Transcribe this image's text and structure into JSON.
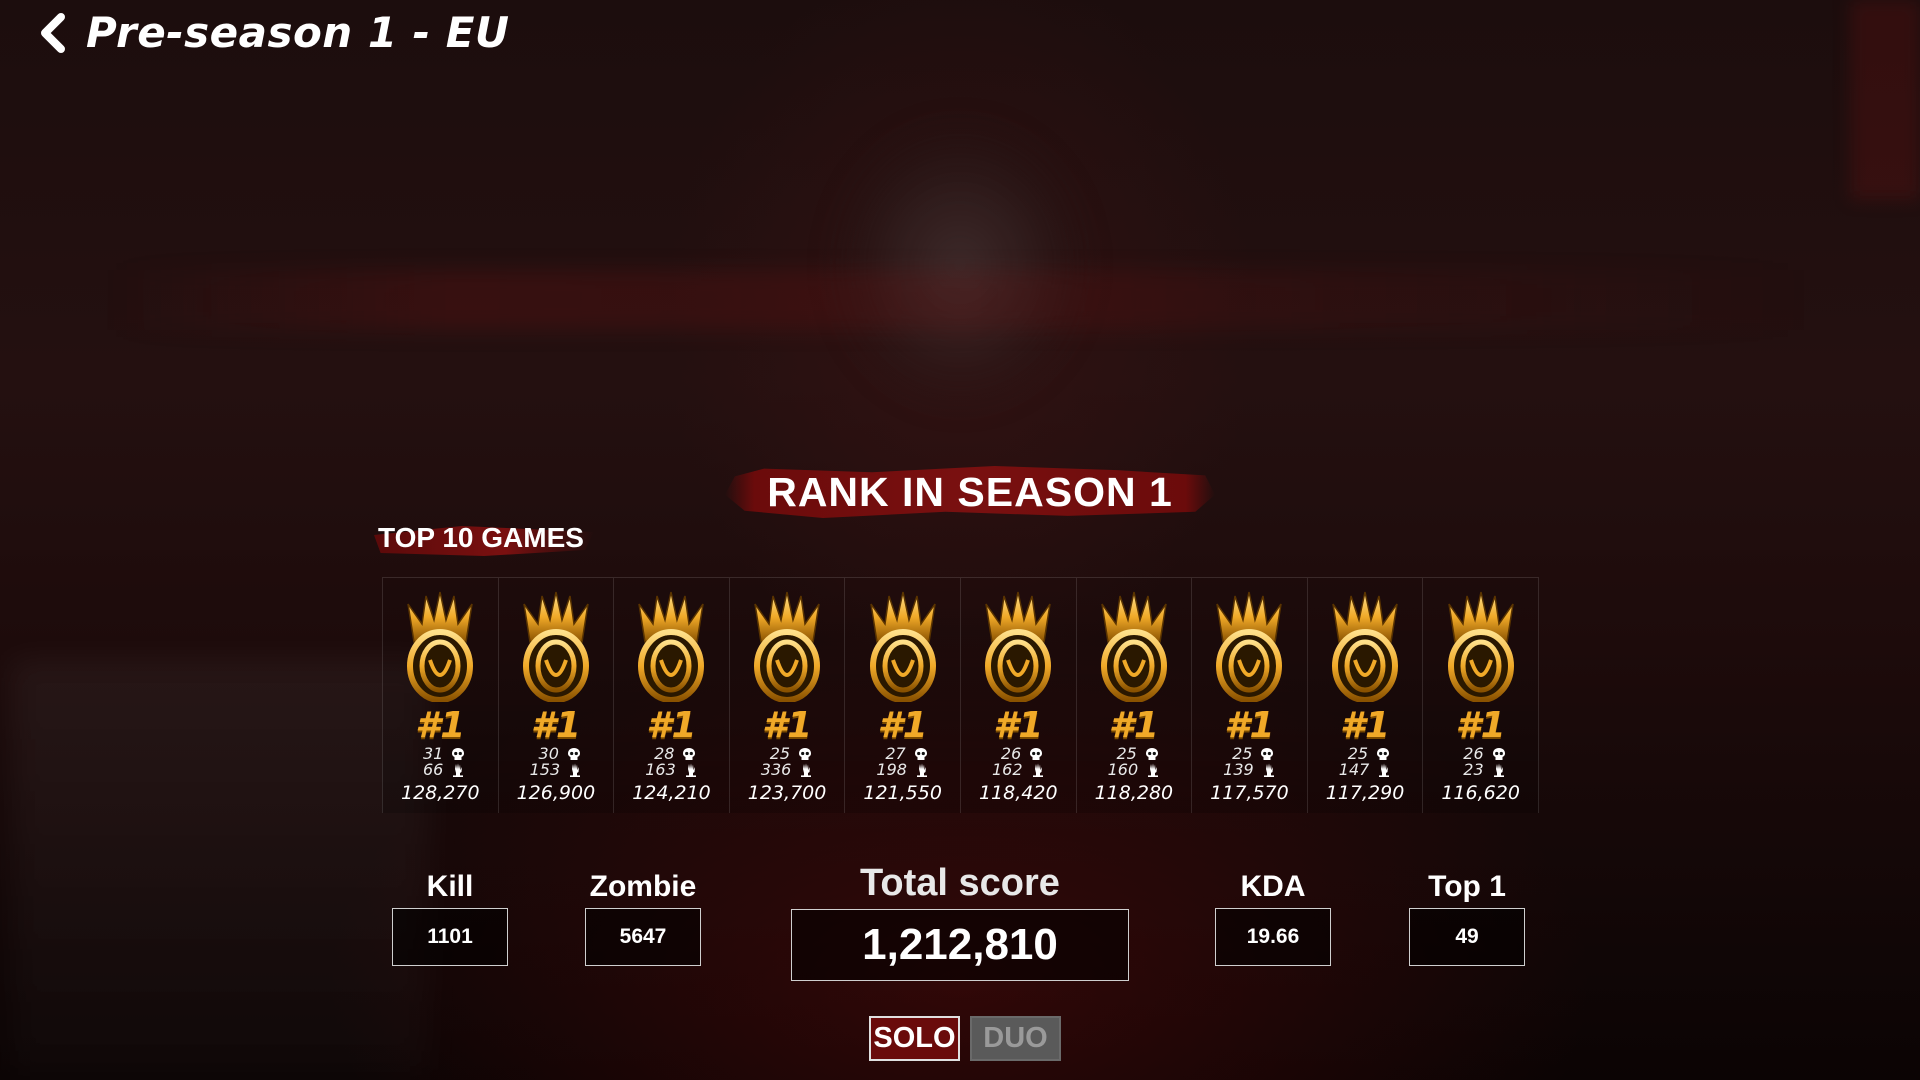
{
  "header": {
    "title": "Pre-season 1 - EU",
    "back_icon": "chevron-left-icon"
  },
  "rank_banner": {
    "label": "RANK IN SEASON 1"
  },
  "top_games": {
    "label": "TOP 10 GAMES",
    "games": [
      {
        "place": "#1",
        "kills": "31",
        "zombies": "66",
        "score": "128,270"
      },
      {
        "place": "#1",
        "kills": "30",
        "zombies": "153",
        "score": "126,900"
      },
      {
        "place": "#1",
        "kills": "28",
        "zombies": "163",
        "score": "124,210"
      },
      {
        "place": "#1",
        "kills": "25",
        "zombies": "336",
        "score": "123,700"
      },
      {
        "place": "#1",
        "kills": "27",
        "zombies": "198",
        "score": "121,550"
      },
      {
        "place": "#1",
        "kills": "26",
        "zombies": "162",
        "score": "118,420"
      },
      {
        "place": "#1",
        "kills": "25",
        "zombies": "160",
        "score": "118,280"
      },
      {
        "place": "#1",
        "kills": "25",
        "zombies": "139",
        "score": "117,570"
      },
      {
        "place": "#1",
        "kills": "25",
        "zombies": "147",
        "score": "117,290"
      },
      {
        "place": "#1",
        "kills": "26",
        "zombies": "23",
        "score": "116,620"
      }
    ]
  },
  "stats": {
    "kill": {
      "label": "Kill",
      "value": "1101"
    },
    "zombie": {
      "label": "Zombie",
      "value": "5647"
    },
    "total": {
      "label": "Total score",
      "value": "1,212,810"
    },
    "kda": {
      "label": "KDA",
      "value": "19.66"
    },
    "top1": {
      "label": "Top 1",
      "value": "49"
    }
  },
  "mode_toggle": {
    "solo": "SOLO",
    "duo": "DUO",
    "selected": "SOLO"
  },
  "colors": {
    "accent_red": "#6a0b0b",
    "gold": "#f0a928"
  }
}
